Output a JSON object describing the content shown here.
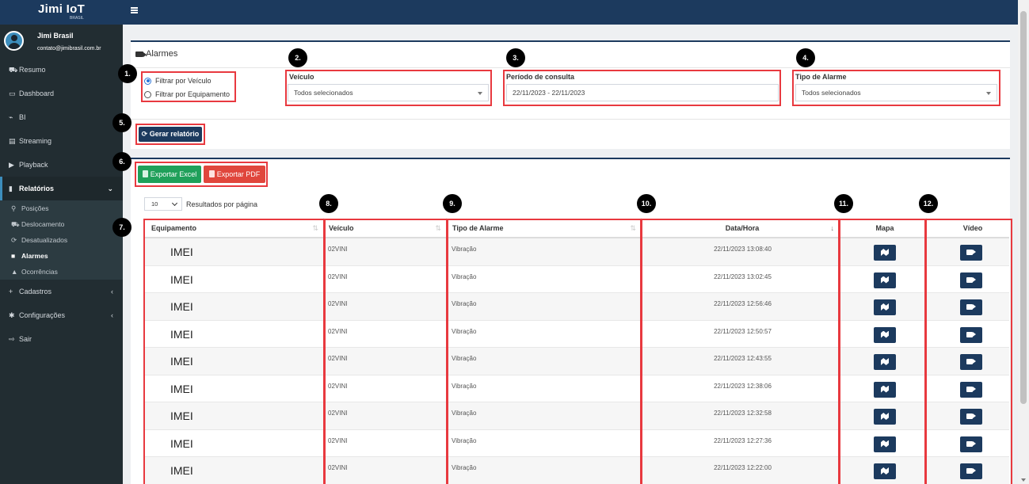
{
  "header": {
    "brand": "Jimi IoT",
    "brand_sub": "BRASIL",
    "menu_icon": "hamburger-icon"
  },
  "user": {
    "name": "Jimi Brasil",
    "email": "contato@jimibrasil.com.br"
  },
  "sidebar": {
    "items": [
      {
        "label": "Resumo",
        "icon": "⛟"
      },
      {
        "label": "Dashboard",
        "icon": "▭"
      },
      {
        "label": "BI",
        "icon": "⌁"
      },
      {
        "label": "Streaming",
        "icon": "▤"
      },
      {
        "label": "Playback",
        "icon": "▶"
      },
      {
        "label": "Relatórios",
        "icon": "▮"
      },
      {
        "label": "Cadastros",
        "icon": "+"
      },
      {
        "label": "Configurações",
        "icon": "✱"
      },
      {
        "label": "Sair",
        "icon": "⇨"
      }
    ],
    "sub_items": [
      {
        "label": "Posições",
        "icon": "⚲"
      },
      {
        "label": "Deslocamento",
        "icon": "⛟"
      },
      {
        "label": "Desatualizados",
        "icon": "⟳"
      },
      {
        "label": "Alarmes",
        "icon": "■"
      },
      {
        "label": "Ocorrências",
        "icon": "▲"
      }
    ],
    "caret_down": "⌄",
    "caret_left": "‹"
  },
  "filters": {
    "title": "Alarmes",
    "radio_vehicle": "Filtrar por Veículo",
    "radio_equipment": "Filtrar por Equipamento",
    "vehicle_label": "Veículo",
    "vehicle_value": "Todos selecionados",
    "period_label": "Período de consulta",
    "period_value": "22/11/2023 - 22/11/2023",
    "alarm_type_label": "Tipo de Alarme",
    "alarm_type_value": "Todos selecionados",
    "generate_button": "Gerar relatório"
  },
  "export": {
    "excel": "Exportar Excel",
    "pdf": "Exportar PDF"
  },
  "pagination": {
    "per_page_value": "10",
    "per_page_label": "Resultados por página"
  },
  "badges": [
    "1.",
    "2.",
    "3.",
    "4.",
    "5.",
    "6.",
    "7.",
    "8.",
    "9.",
    "10.",
    "11.",
    "12."
  ],
  "table": {
    "headers": {
      "equipamento": "Equipamento",
      "veiculo": "Veículo",
      "tipo": "Tipo de Alarme",
      "datahora": "Data/Hora",
      "mapa": "Mapa",
      "video": "Vídeo"
    },
    "rows": [
      {
        "equipamento": "IMEI",
        "veiculo": "02VINI",
        "tipo": "Vibração",
        "datahora": "22/11/2023 13:08:40"
      },
      {
        "equipamento": "IMEI",
        "veiculo": "02VINI",
        "tipo": "Vibração",
        "datahora": "22/11/2023 13:02:45"
      },
      {
        "equipamento": "IMEI",
        "veiculo": "02VINI",
        "tipo": "Vibração",
        "datahora": "22/11/2023 12:56:46"
      },
      {
        "equipamento": "IMEI",
        "veiculo": "02VINI",
        "tipo": "Vibração",
        "datahora": "22/11/2023 12:50:57"
      },
      {
        "equipamento": "IMEI",
        "veiculo": "02VINI",
        "tipo": "Vibração",
        "datahora": "22/11/2023 12:43:55"
      },
      {
        "equipamento": "IMEI",
        "veiculo": "02VINI",
        "tipo": "Vibração",
        "datahora": "22/11/2023 12:38:06"
      },
      {
        "equipamento": "IMEI",
        "veiculo": "02VINI",
        "tipo": "Vibração",
        "datahora": "22/11/2023 12:32:58"
      },
      {
        "equipamento": "IMEI",
        "veiculo": "02VINI",
        "tipo": "Vibração",
        "datahora": "22/11/2023 12:27:36"
      },
      {
        "equipamento": "IMEI",
        "veiculo": "02VINI",
        "tipo": "Vibração",
        "datahora": "22/11/2023 12:22:00"
      }
    ]
  },
  "colors": {
    "primary": "#1c3a5e",
    "sidebar": "#222d32",
    "highlight": "#e8393f",
    "excel": "#1fa05a",
    "pdf": "#e0463c"
  }
}
